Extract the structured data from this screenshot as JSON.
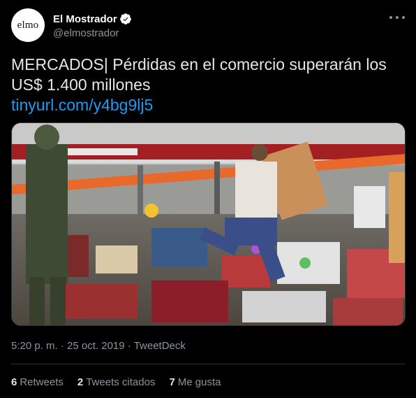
{
  "author": {
    "avatar_text": "elmo",
    "display_name": "El Mostrador",
    "handle": "@elmostrador",
    "verified": true
  },
  "tweet": {
    "text": "MERCADOS| Pérdidas en el comercio superarán los US$ 1.400 millones",
    "link": "tinyurl.com/y4bg9lj5"
  },
  "meta": {
    "time": "5:20 p. m.",
    "separator1": " · ",
    "date": "25 oct. 2019",
    "separator2": " · ",
    "source": "TweetDeck"
  },
  "stats": {
    "retweets_count": "6",
    "retweets_label": "Retweets",
    "quotes_count": "2",
    "quotes_label": "Tweets citados",
    "likes_count": "7",
    "likes_label": "Me gusta"
  },
  "colors": {
    "background": "#000000",
    "link": "#1d9bf0",
    "secondary_text": "#8b949e",
    "verified_badge": "#ffffff",
    "avatar_dot": "#f26b1f"
  },
  "icons": [
    "verified-icon",
    "more-icon"
  ]
}
